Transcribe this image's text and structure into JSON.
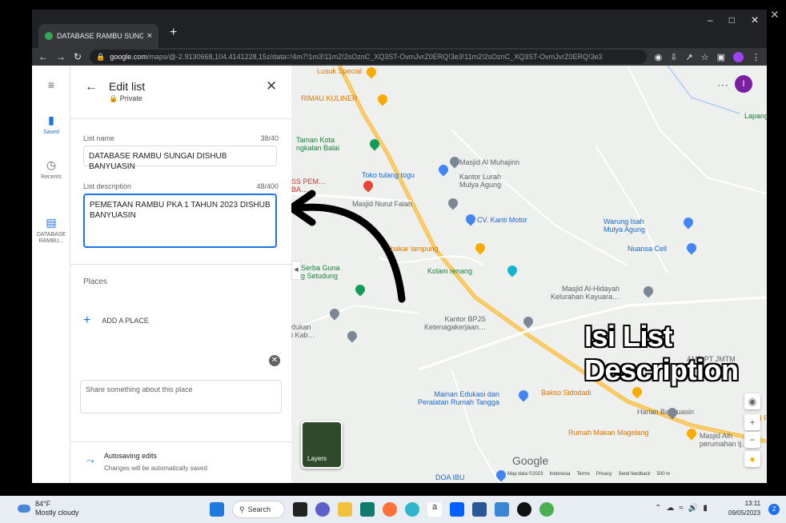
{
  "browser": {
    "tab_title": "DATABASE RAMBU SUNGAI DIS…",
    "tab_close": "×",
    "new_tab": "+",
    "url_domain": "google.com",
    "url_path": "/maps/@-2.9130668,104.4141228,15z/data=!4m7!1m3!11m2!2sOznC_XQ3ST-OvmJvrZ0ERQ!3e3!11m2!2sOznC_XQ3ST-OvmJvrZ0ERQ!3e3",
    "win_min": "–",
    "win_max": "□",
    "win_close": "✕",
    "profile_initial": "I"
  },
  "rail": {
    "menu": "≡",
    "saved": "Saved",
    "recents": "Recents",
    "list": "DATABASE RAMBU..."
  },
  "panel": {
    "title": "Edit list",
    "subtitle": "🔒 Private",
    "list_name_label": "List name",
    "list_name_count": "38/40",
    "list_name_value": "DATABASE RAMBU SUNGAI DISHUB BANYUASIN",
    "desc_label": "List description",
    "desc_count": "48/400",
    "desc_value": "PEMETAAN RAMBU PKA 1 TAHUN 2023 DISHUB BANYUASIN",
    "places_label": "Places",
    "add_place": "ADD A PLACE",
    "note_placeholder": "Share something about this place",
    "autosave_title": "Autosaving edits",
    "autosave_sub": "Changes will be automatically saved"
  },
  "map": {
    "labels": [
      {
        "text": "Lusuk Special",
        "cls": "orange"
      },
      {
        "text": "RIMAU KULINER",
        "cls": "orange"
      },
      {
        "text": "Taman Kota\nngkalan Balai",
        "cls": "green"
      },
      {
        "text": "Masjid Al Muhajirin",
        "cls": ""
      },
      {
        "text": "Toko tulang togu",
        "cls": "blue"
      },
      {
        "text": "Kantor Lurah\nMulya Agung",
        "cls": ""
      },
      {
        "text": "SS PEM…\nBA…",
        "cls": "red"
      },
      {
        "text": "Masjid Nurul Falah",
        "cls": ""
      },
      {
        "text": "CV. Kanti Motor",
        "cls": "blue"
      },
      {
        "text": "Warung Isah\nMulya Agung",
        "cls": "blue"
      },
      {
        "text": "bakar lampung",
        "cls": "orange"
      },
      {
        "text": "Nuansa Cell",
        "cls": "blue"
      },
      {
        "text": "Serba Guna\ng Setudung",
        "cls": "green"
      },
      {
        "text": "Kolam renang",
        "cls": "green"
      },
      {
        "text": "Masjid Al-Hidayah\nKelurahan Kayuara…",
        "cls": ""
      },
      {
        "text": "Kantor BPJS\nKetenagakerjaan…",
        "cls": ""
      },
      {
        "text": "dukan\ni Kab…",
        "cls": ""
      },
      {
        "text": "AMP PT JMTM\nPalembang",
        "cls": ""
      },
      {
        "text": "Bakso Sidodadi",
        "cls": "orange"
      },
      {
        "text": "Mainan Edukasi dan\nPeralatan Rumah Tangga",
        "cls": "blue"
      },
      {
        "text": "Harian Banyuasin",
        "cls": ""
      },
      {
        "text": "Rumah Makan Magelang",
        "cls": "orange"
      },
      {
        "text": "Masjid Alh\nperumahan tj…",
        "cls": ""
      },
      {
        "text": "DOA IBU",
        "cls": "blue"
      },
      {
        "text": "Lapang",
        "cls": "green"
      },
      {
        "text": "M P",
        "cls": "orange"
      }
    ],
    "annotation": "Isi List Description",
    "layers_label": "Layers",
    "google": "Google",
    "footer": [
      "Map data ©2023",
      "Indonesia",
      "Terms",
      "Privacy",
      "Send feedback",
      "500 m"
    ]
  },
  "taskbar": {
    "temp": "84°F",
    "weather": "Mostly cloudy",
    "search": "Search",
    "time": "13:11",
    "date": "09/05/2023",
    "notifications": "2"
  }
}
